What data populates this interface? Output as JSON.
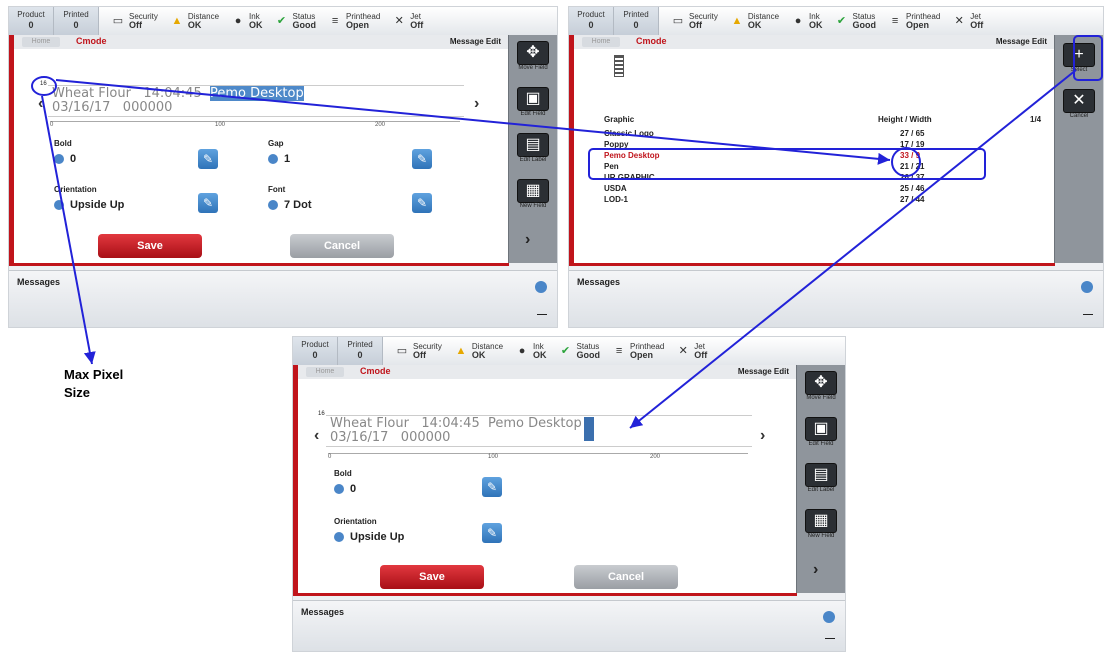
{
  "status_bar": {
    "product_label": "Product",
    "product_value": "0",
    "printed_label": "Printed",
    "printed_value": "0",
    "security_label": "Security",
    "security_value": "Off",
    "distance_label": "Distance",
    "distance_value": "OK",
    "ink_label": "Ink",
    "ink_value": "OK",
    "status_label": "Status",
    "status_value": "Good",
    "printhead_label": "Printhead",
    "printhead_value": "Open",
    "jet_label": "Jet",
    "jet_value": "Off"
  },
  "brand": "Cmode",
  "home_tab": "Home",
  "page_title": "Message Edit",
  "message": {
    "line1": "Wheat Flour",
    "time": "14:04:45",
    "field_selected": "Pemo Desktop",
    "line2": "03/16/17",
    "counter": "000000",
    "pixel_size": "16"
  },
  "ruler": {
    "ticks": [
      "0",
      "100",
      "200"
    ]
  },
  "fields": {
    "bold_label": "Bold",
    "bold_value": "0",
    "gap_label": "Gap",
    "gap_value": "1",
    "orientation_label": "Orientation",
    "orientation_value": "Upside Up",
    "font_label": "Font",
    "font_value": "7 Dot"
  },
  "buttons": {
    "save": "Save",
    "cancel": "Cancel"
  },
  "sidebar": {
    "items": [
      "Move Field",
      "Edit Field",
      "Edit Label",
      "New Field"
    ],
    "select_label": "Select",
    "cancel_label": "Cancel",
    "next_icon": "chevron-right-icon"
  },
  "graphic_list": {
    "col_graphic": "Graphic",
    "col_hw": "Height / Width",
    "col_extra": "1/4",
    "rows": [
      {
        "name": "Classic Logo",
        "height": "27",
        "width": "65"
      },
      {
        "name": "Poppy",
        "height": "17",
        "width": "19"
      },
      {
        "name": "Pemo Desktop",
        "height": "33",
        "width": "9"
      },
      {
        "name": "Pen",
        "height": "21",
        "width": "21"
      },
      {
        "name": "UR GRAPHIC",
        "height": "26",
        "width": "37"
      },
      {
        "name": "USDA",
        "height": "25",
        "width": "46"
      },
      {
        "name": "LOD-1",
        "height": "27",
        "width": "44"
      }
    ]
  },
  "footer": {
    "label": "Messages",
    "minimize": "—"
  },
  "annotation": {
    "line1": "Max Pixel",
    "line2": "Size"
  },
  "colors": {
    "accent_red": "#c0141b",
    "annotation_blue": "#2222d8",
    "edit_blue": "#3f86cc"
  }
}
